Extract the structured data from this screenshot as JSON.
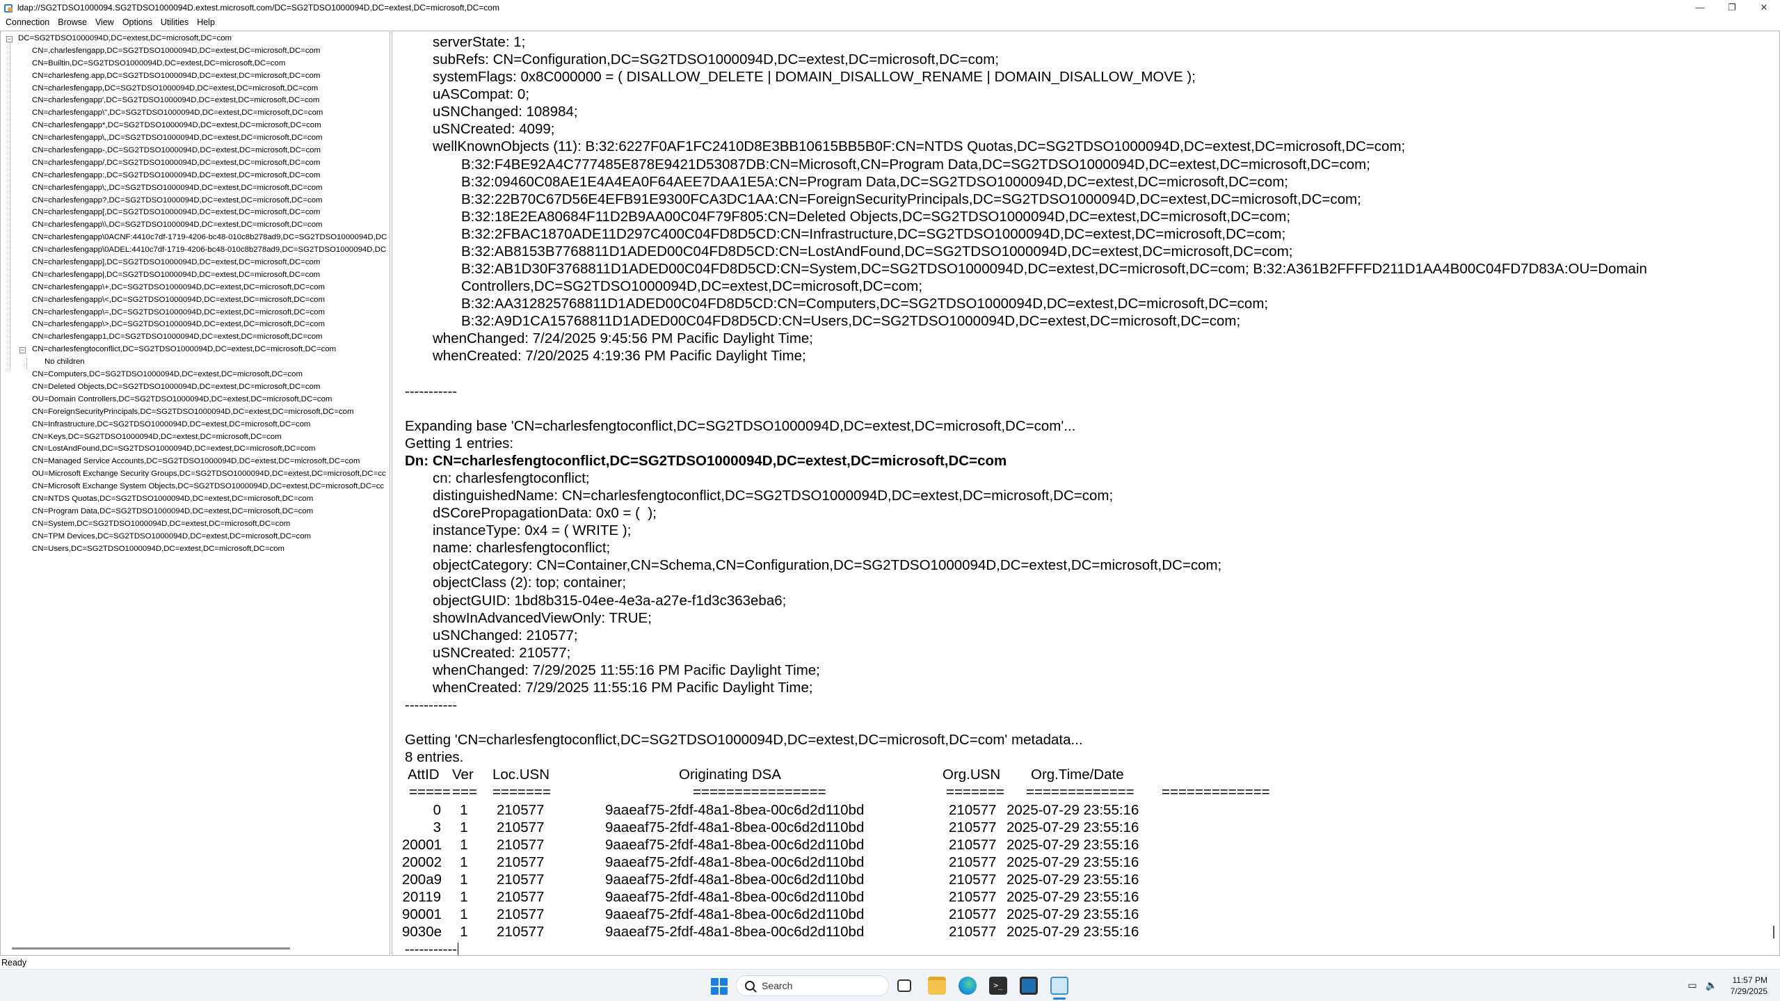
{
  "window": {
    "title": "ldap://SG2TDSO1000094.SG2TDSO1000094D.extest.microsoft.com/DC=SG2TDSO1000094D,DC=extest,DC=microsoft,DC=com",
    "controls": {
      "minimize": "—",
      "maximize": "❐",
      "close": "✕"
    }
  },
  "menu": [
    "Connection",
    "Browse",
    "View",
    "Options",
    "Utilities",
    "Help"
  ],
  "tree": {
    "root": "DC=SG2TDSO1000094D,DC=extest,DC=microsoft,DC=com",
    "items": [
      "CN=,charlesfengapp,DC=SG2TDSO1000094D,DC=extest,DC=microsoft,DC=com",
      "CN=Builtin,DC=SG2TDSO1000094D,DC=extest,DC=microsoft,DC=com",
      "CN=charlesfeng.app,DC=SG2TDSO1000094D,DC=extest,DC=microsoft,DC=com",
      "CN=charlesfengapp,DC=SG2TDSO1000094D,DC=extest,DC=microsoft,DC=com",
      "CN=charlesfengapp',DC=SG2TDSO1000094D,DC=extest,DC=microsoft,DC=com",
      "CN=charlesfengapp\\\",DC=SG2TDSO1000094D,DC=extest,DC=microsoft,DC=com",
      "CN=charlesfengapp*,DC=SG2TDSO1000094D,DC=extest,DC=microsoft,DC=com",
      "CN=charlesfengapp\\,,DC=SG2TDSO1000094D,DC=extest,DC=microsoft,DC=com",
      "CN=charlesfengapp-,DC=SG2TDSO1000094D,DC=extest,DC=microsoft,DC=com",
      "CN=charlesfengapp/,DC=SG2TDSO1000094D,DC=extest,DC=microsoft,DC=com",
      "CN=charlesfengapp:,DC=SG2TDSO1000094D,DC=extest,DC=microsoft,DC=com",
      "CN=charlesfengapp\\;,DC=SG2TDSO1000094D,DC=extest,DC=microsoft,DC=com",
      "CN=charlesfengapp?,DC=SG2TDSO1000094D,DC=extest,DC=microsoft,DC=com",
      "CN=charlesfengapp[,DC=SG2TDSO1000094D,DC=extest,DC=microsoft,DC=com",
      "CN=charlesfengapp\\\\,DC=SG2TDSO1000094D,DC=extest,DC=microsoft,DC=com",
      "CN=charlesfengapp\\0ACNF:4410c7df-1719-4206-bc48-010c8b278ad9,DC=SG2TDSO1000094D,DC",
      "CN=charlesfengapp\\0ADEL:4410c7df-1719-4206-bc48-010c8b278ad9,DC=SG2TDSO1000094D,DC",
      "CN=charlesfengapp],DC=SG2TDSO1000094D,DC=extest,DC=microsoft,DC=com",
      "CN=charlesfengapp|,DC=SG2TDSO1000094D,DC=extest,DC=microsoft,DC=com",
      "CN=charlesfengapp\\+,DC=SG2TDSO1000094D,DC=extest,DC=microsoft,DC=com",
      "CN=charlesfengapp\\<,DC=SG2TDSO1000094D,DC=extest,DC=microsoft,DC=com",
      "CN=charlesfengapp\\=,DC=SG2TDSO1000094D,DC=extest,DC=microsoft,DC=com",
      "CN=charlesfengapp\\>,DC=SG2TDSO1000094D,DC=extest,DC=microsoft,DC=com",
      "CN=charlesfengapp1,DC=SG2TDSO1000094D,DC=extest,DC=microsoft,DC=com",
      "CN=charlesfengtoconflict,DC=SG2TDSO1000094D,DC=extest,DC=microsoft,DC=com",
      "No children",
      "CN=Computers,DC=SG2TDSO1000094D,DC=extest,DC=microsoft,DC=com",
      "CN=Deleted Objects,DC=SG2TDSO1000094D,DC=extest,DC=microsoft,DC=com",
      "OU=Domain Controllers,DC=SG2TDSO1000094D,DC=extest,DC=microsoft,DC=com",
      "CN=ForeignSecurityPrincipals,DC=SG2TDSO1000094D,DC=extest,DC=microsoft,DC=com",
      "CN=Infrastructure,DC=SG2TDSO1000094D,DC=extest,DC=microsoft,DC=com",
      "CN=Keys,DC=SG2TDSO1000094D,DC=extest,DC=microsoft,DC=com",
      "CN=LostAndFound,DC=SG2TDSO1000094D,DC=extest,DC=microsoft,DC=com",
      "CN=Managed Service Accounts,DC=SG2TDSO1000094D,DC=extest,DC=microsoft,DC=com",
      "OU=Microsoft Exchange Security Groups,DC=SG2TDSO1000094D,DC=extest,DC=microsoft,DC=cc",
      "CN=Microsoft Exchange System Objects,DC=SG2TDSO1000094D,DC=extest,DC=microsoft,DC=cc",
      "CN=NTDS Quotas,DC=SG2TDSO1000094D,DC=extest,DC=microsoft,DC=com",
      "CN=Program Data,DC=SG2TDSO1000094D,DC=extest,DC=microsoft,DC=com",
      "CN=System,DC=SG2TDSO1000094D,DC=extest,DC=microsoft,DC=com",
      "CN=TPM Devices,DC=SG2TDSO1000094D,DC=extest,DC=microsoft,DC=com",
      "CN=Users,DC=SG2TDSO1000094D,DC=extest,DC=microsoft,DC=com"
    ]
  },
  "output": {
    "lines": [
      "serverState: 1;",
      "subRefs: CN=Configuration,DC=SG2TDSO1000094D,DC=extest,DC=microsoft,DC=com;",
      "systemFlags: 0x8C000000 = ( DISALLOW_DELETE | DOMAIN_DISALLOW_RENAME | DOMAIN_DISALLOW_MOVE );",
      "uASCompat: 0;",
      "uSNChanged: 108984;",
      "uSNCreated: 4099;",
      "wellKnownObjects (11): B:32:6227F0AF1FC2410D8E3BB10615BB5B0F:CN=NTDS Quotas,DC=SG2TDSO1000094D,DC=extest,DC=microsoft,DC=com;",
      "B:32:F4BE92A4C777485E878E9421D53087DB:CN=Microsoft,CN=Program Data,DC=SG2TDSO1000094D,DC=extest,DC=microsoft,DC=com;",
      "B:32:09460C08AE1E4A4EA0F64AEE7DAA1E5A:CN=Program Data,DC=SG2TDSO1000094D,DC=extest,DC=microsoft,DC=com;",
      "B:32:22B70C67D56E4EFB91E9300FCA3DC1AA:CN=ForeignSecurityPrincipals,DC=SG2TDSO1000094D,DC=extest,DC=microsoft,DC=com;",
      "B:32:18E2EA80684F11D2B9AA00C04F79F805:CN=Deleted Objects,DC=SG2TDSO1000094D,DC=extest,DC=microsoft,DC=com;",
      "B:32:2FBAC1870ADE11D297C400C04FD8D5CD:CN=Infrastructure,DC=SG2TDSO1000094D,DC=extest,DC=microsoft,DC=com;",
      "B:32:AB8153B7768811D1ADED00C04FD8D5CD:CN=LostAndFound,DC=SG2TDSO1000094D,DC=extest,DC=microsoft,DC=com;",
      "B:32:AB1D30F3768811D1ADED00C04FD8D5CD:CN=System,DC=SG2TDSO1000094D,DC=extest,DC=microsoft,DC=com; B:32:A361B2FFFFD211D1AA4B00C04FD7D83A:OU=Domain",
      "Controllers,DC=SG2TDSO1000094D,DC=extest,DC=microsoft,DC=com;",
      "B:32:AA312825768811D1ADED00C04FD8D5CD:CN=Computers,DC=SG2TDSO1000094D,DC=extest,DC=microsoft,DC=com;",
      "B:32:A9D1CA15768811D1ADED00C04FD8D5CD:CN=Users,DC=SG2TDSO1000094D,DC=extest,DC=microsoft,DC=com;",
      "whenChanged: 7/24/2025 9:45:56 PM Pacific Daylight Time;",
      "whenCreated: 7/20/2025 4:19:36 PM Pacific Daylight Time;",
      "-----------",
      "Expanding base 'CN=charlesfengtoconflict,DC=SG2TDSO1000094D,DC=extest,DC=microsoft,DC=com'...",
      "Getting 1 entries:",
      "Dn: CN=charlesfengtoconflict,DC=SG2TDSO1000094D,DC=extest,DC=microsoft,DC=com",
      "cn: charlesfengtoconflict;",
      "distinguishedName: CN=charlesfengtoconflict,DC=SG2TDSO1000094D,DC=extest,DC=microsoft,DC=com;",
      "dSCorePropagationData: 0x0 = (  );",
      "instanceType: 0x4 = ( WRITE );",
      "name: charlesfengtoconflict;",
      "objectCategory: CN=Container,CN=Schema,CN=Configuration,DC=SG2TDSO1000094D,DC=extest,DC=microsoft,DC=com;",
      "objectClass (2): top; container;",
      "objectGUID: 1bd8b315-04ee-4e3a-a27e-f1d3c363eba6;",
      "showInAdvancedViewOnly: TRUE;",
      "uSNChanged: 210577;",
      "uSNCreated: 210577;",
      "whenChanged: 7/29/2025 11:55:16 PM Pacific Daylight Time;",
      "whenCreated: 7/29/2025 11:55:16 PM Pacific Daylight Time;",
      "-----------",
      "Getting 'CN=charlesfengtoconflict,DC=SG2TDSO1000094D,DC=extest,DC=microsoft,DC=com' metadata...",
      "8 entries."
    ],
    "metadata": {
      "headers": [
        "AttID",
        "Ver",
        "Loc.USN",
        "Originating DSA",
        "Org.USN",
        "Org.Time/Date"
      ],
      "underlines": [
        "=====",
        "===",
        "=======",
        "================",
        "=======",
        "=============",
        "============="
      ],
      "rows": [
        [
          "0",
          "1",
          "210577",
          "9aaeaf75-2fdf-48a1-8bea-00c6d2d110bd",
          "210577",
          "2025-07-29 23:55:16"
        ],
        [
          "3",
          "1",
          "210577",
          "9aaeaf75-2fdf-48a1-8bea-00c6d2d110bd",
          "210577",
          "2025-07-29 23:55:16"
        ],
        [
          "20001",
          "1",
          "210577",
          "9aaeaf75-2fdf-48a1-8bea-00c6d2d110bd",
          "210577",
          "2025-07-29 23:55:16"
        ],
        [
          "20002",
          "1",
          "210577",
          "9aaeaf75-2fdf-48a1-8bea-00c6d2d110bd",
          "210577",
          "2025-07-29 23:55:16"
        ],
        [
          "200a9",
          "1",
          "210577",
          "9aaeaf75-2fdf-48a1-8bea-00c6d2d110bd",
          "210577",
          "2025-07-29 23:55:16"
        ],
        [
          "20119",
          "1",
          "210577",
          "9aaeaf75-2fdf-48a1-8bea-00c6d2d110bd",
          "210577",
          "2025-07-29 23:55:16"
        ],
        [
          "90001",
          "1",
          "210577",
          "9aaeaf75-2fdf-48a1-8bea-00c6d2d110bd",
          "210577",
          "2025-07-29 23:55:16"
        ],
        [
          "9030e",
          "1",
          "210577",
          "9aaeaf75-2fdf-48a1-8bea-00c6d2d110bd",
          "210577",
          "2025-07-29 23:55:16"
        ]
      ],
      "footer": "-----------"
    }
  },
  "status": "Ready",
  "taskbar": {
    "search_placeholder": "Search",
    "terminal_glyph": ">_",
    "clock_time": "11:57 PM",
    "clock_date": "7/29/2025"
  }
}
